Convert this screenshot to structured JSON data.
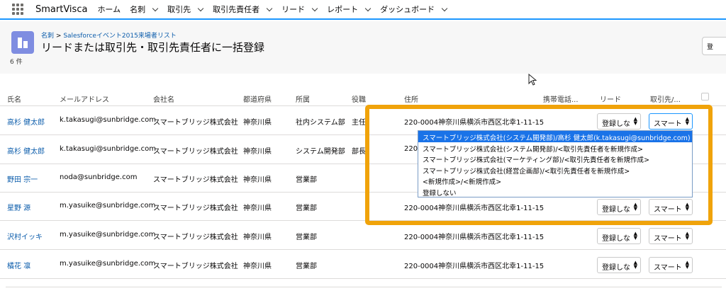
{
  "app": {
    "name": "SmartVisca"
  },
  "nav": [
    {
      "label": "ホーム",
      "chevron": false
    },
    {
      "label": "名刺",
      "chevron": true
    },
    {
      "label": "取引先",
      "chevron": true
    },
    {
      "label": "取引先責任者",
      "chevron": true
    },
    {
      "label": "リード",
      "chevron": true
    },
    {
      "label": "レポート",
      "chevron": true
    },
    {
      "label": "ダッシュボード",
      "chevron": true
    }
  ],
  "header": {
    "breadcrumb_root": "名刺",
    "breadcrumb_sep": ">",
    "breadcrumb_list": "Salesforceイベント2015来場者リスト",
    "title": "リードまたは取引先・取引先責任者に一括登録",
    "count": "6 件",
    "right_button_label": "登"
  },
  "table": {
    "columns": [
      "氏名",
      "メールアドレス",
      "会社名",
      "都道府県",
      "所属",
      "役職",
      "住所",
      "携帯電話...",
      "リード",
      "取引先/..."
    ],
    "rows": [
      {
        "name": "高杉 健太郎",
        "email": "k.takasugi@sunbridge.com",
        "company": "スマートブリッジ株式会社",
        "pref": "神奈川県",
        "dept": "社内システム部",
        "title": "主任",
        "address": "220-0004神奈川県横浜市西区北幸1-11-15",
        "lead": "登録しな",
        "account": "スマート"
      },
      {
        "name": "高杉 健太郎",
        "email": "k.takasugi@sunbridge.com",
        "company": "スマートブリッジ株式会社",
        "pref": "神奈川県",
        "dept": "システム開発部",
        "title": "部長",
        "address": "220-",
        "lead": "",
        "account": ""
      },
      {
        "name": "野田 宗一",
        "email": "noda@sunbridge.com",
        "company": "スマートブリッジ株式会社",
        "pref": "神奈川県",
        "dept": "営業部",
        "title": "",
        "address": "",
        "lead": "",
        "account": ""
      },
      {
        "name": "星野 源",
        "email": "m.yasuike@sunbridge.com",
        "company": "スマートブリッジ株式会社",
        "pref": "神奈川県",
        "dept": "営業部",
        "title": "",
        "address": "220-0004神奈川県横浜市西区北幸1-11-15",
        "lead": "登録しな",
        "account": "スマート"
      },
      {
        "name": "沢村イッキ",
        "email": "m.yasuike@sunbridge.com",
        "company": "スマートブリッジ株式会社",
        "pref": "神奈川県",
        "dept": "営業部",
        "title": "",
        "address": "220-0004神奈川県横浜市西区北幸1-11-15",
        "lead": "登録しな",
        "account": "スマート"
      },
      {
        "name": "橘花 凛",
        "email": "m.yasuike@sunbridge.com",
        "company": "スマートブリッジ株式会社",
        "pref": "神奈川県",
        "dept": "営業部",
        "title": "",
        "address": "220-0004神奈川県横浜市西区北幸1-11-15",
        "lead": "登録しな",
        "account": "スマート"
      }
    ]
  },
  "dropdown": {
    "options": [
      "スマートブリッジ株式会社(システム開発部)/高杉 健太郎(k.takasugi@sunbridge.com)",
      "スマートブリッジ株式会社(システム開発部)/<取引先責任者を新規作成>",
      "スマートブリッジ株式会社(マーケティング部)/<取引先責任者を新規作成>",
      "スマートブリッジ株式会社(経営企画部)/<取引先責任者を新規作成>",
      "<新規作成>/<新規作成>",
      "登録しない"
    ],
    "selected_index": 0
  },
  "colors": {
    "accent": "#1b96ff",
    "link": "#0b5cab",
    "highlight": "#f0a30a",
    "object_icon": "#7f8de1",
    "selected_option": "#1a73e8"
  }
}
